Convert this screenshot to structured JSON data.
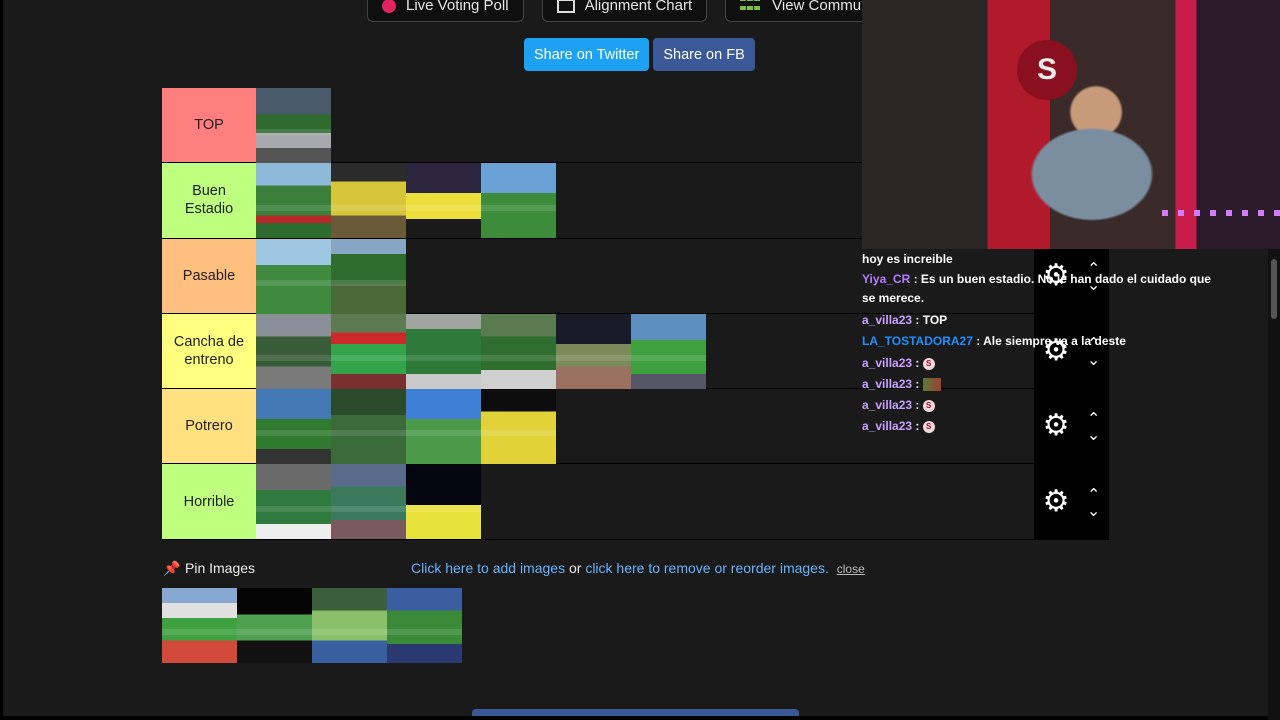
{
  "nav": {
    "live_voting": "Live Voting Poll",
    "alignment": "Alignment Chart",
    "community": "View Community R"
  },
  "share": {
    "twitter": "Share on Twitter",
    "fb": "Share on FB"
  },
  "tiers": [
    {
      "label": "TOP",
      "color": "#ff7f7f",
      "images": [
        "t1"
      ]
    },
    {
      "label": "Buen Estadio",
      "color": "#bfff7f",
      "images": [
        "t2",
        "t3",
        "t4",
        "t5"
      ]
    },
    {
      "label": "Pasable",
      "color": "#ffbf7f",
      "images": [
        "t6",
        "t7"
      ]
    },
    {
      "label": "Cancha de entreno",
      "color": "#ffff7f",
      "images": [
        "t8",
        "t9",
        "t10",
        "t11",
        "t12",
        "t13"
      ]
    },
    {
      "label": "Potrero",
      "color": "#ffdf80",
      "images": [
        "t14",
        "t15",
        "t16",
        "t17"
      ]
    },
    {
      "label": "Horrible",
      "color": "#bfff7f",
      "images": [
        "t18",
        "t19",
        "t20"
      ]
    }
  ],
  "pin": {
    "label": "Pin Images",
    "add_link": "Click here to add images",
    "or": " or ",
    "reorder_link": "click here to remove or reorder images.",
    "close": "close",
    "images": [
      "p1",
      "p2",
      "p3",
      "p4"
    ]
  },
  "icons": {
    "gear": "gear-icon",
    "up": "chevron-up-icon",
    "down": "chevron-down-icon",
    "pin": "pushpin-icon"
  },
  "cam": {
    "logo": "S"
  },
  "chat": [
    {
      "user": "",
      "text": "hoy es increible",
      "color": "#ffffff"
    },
    {
      "user": "Yiya_CR",
      "text": "Es un buen estadio. No le han dado el cuidado que se merece.",
      "color": "#b57bff"
    },
    {
      "user": "a_villa23",
      "text": "TOP",
      "color": "#c9a0ff"
    },
    {
      "user": "LA_TOSTADORA27",
      "text": "Ale siempre va a la deste",
      "color": "#1e90ff"
    },
    {
      "user": "a_villa23",
      "text": "",
      "emote": "S",
      "color": "#c9a0ff"
    },
    {
      "user": "a_villa23",
      "text": "",
      "emote_img": true,
      "color": "#c9a0ff"
    },
    {
      "user": "a_villa23",
      "text": "",
      "emote": "S",
      "color": "#c9a0ff"
    },
    {
      "user": "a_villa23",
      "text": "",
      "emote": "S",
      "color": "#c9a0ff"
    }
  ]
}
